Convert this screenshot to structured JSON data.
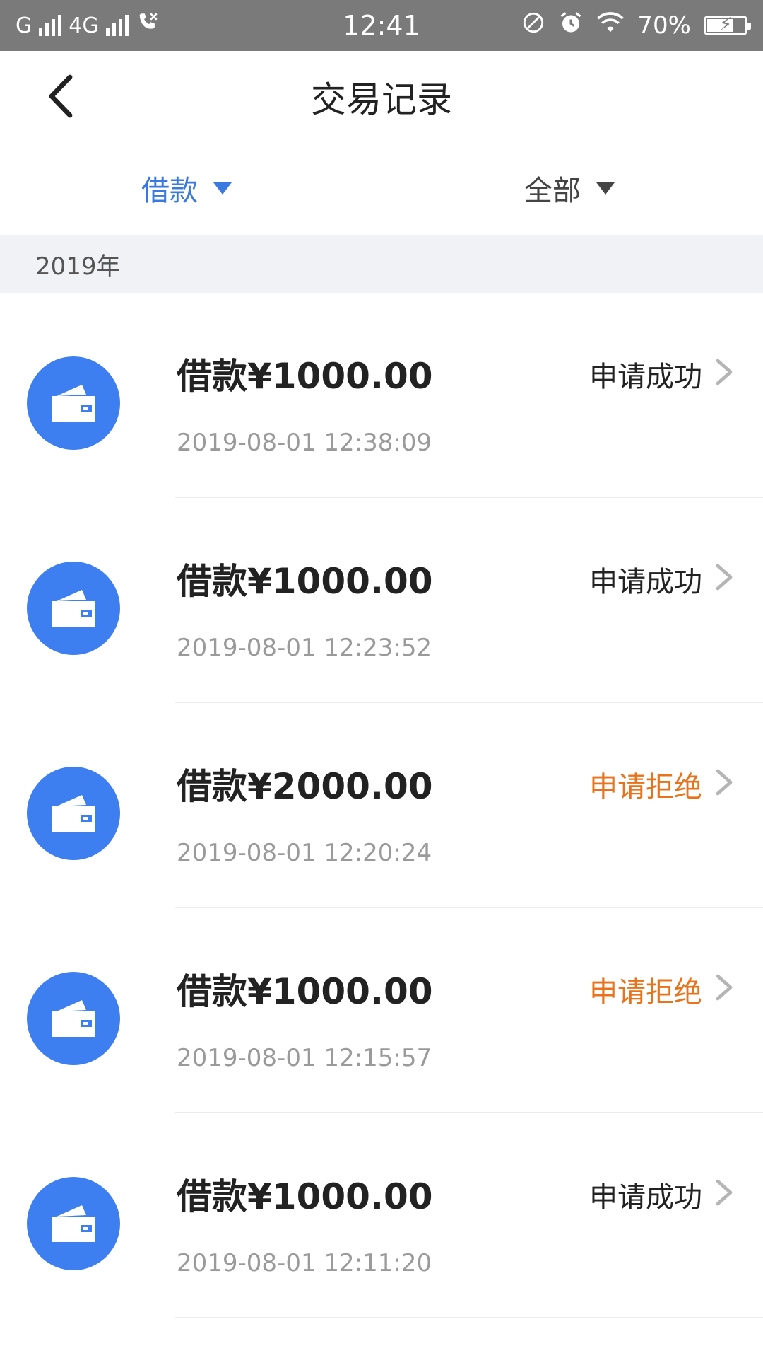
{
  "status_bar": {
    "carrier1": "G",
    "network": "4G",
    "time": "12:41",
    "battery": "70%",
    "battery_level": 0.7
  },
  "header": {
    "title": "交易记录"
  },
  "filters": {
    "type_label": "借款",
    "status_label": "全部"
  },
  "section": {
    "year": "2019年"
  },
  "transactions": [
    {
      "amount": "借款¥1000.00",
      "time": "2019-08-01 12:38:09",
      "status": "申请成功",
      "status_color": "#222222"
    },
    {
      "amount": "借款¥1000.00",
      "time": "2019-08-01 12:23:52",
      "status": "申请成功",
      "status_color": "#222222"
    },
    {
      "amount": "借款¥2000.00",
      "time": "2019-08-01 12:20:24",
      "status": "申请拒绝",
      "status_color": "#e8731a"
    },
    {
      "amount": "借款¥1000.00",
      "time": "2019-08-01 12:15:57",
      "status": "申请拒绝",
      "status_color": "#e8731a"
    },
    {
      "amount": "借款¥1000.00",
      "time": "2019-08-01 12:11:20",
      "status": "申请成功",
      "status_color": "#222222"
    }
  ],
  "colors": {
    "accent": "#3a79e0",
    "avatar_bg": "#3d7ff0",
    "rejected": "#e8731a"
  },
  "icons": {
    "back": "back-arrow-icon",
    "wallet": "wallet-icon",
    "chevron": "chevron-right-icon"
  }
}
